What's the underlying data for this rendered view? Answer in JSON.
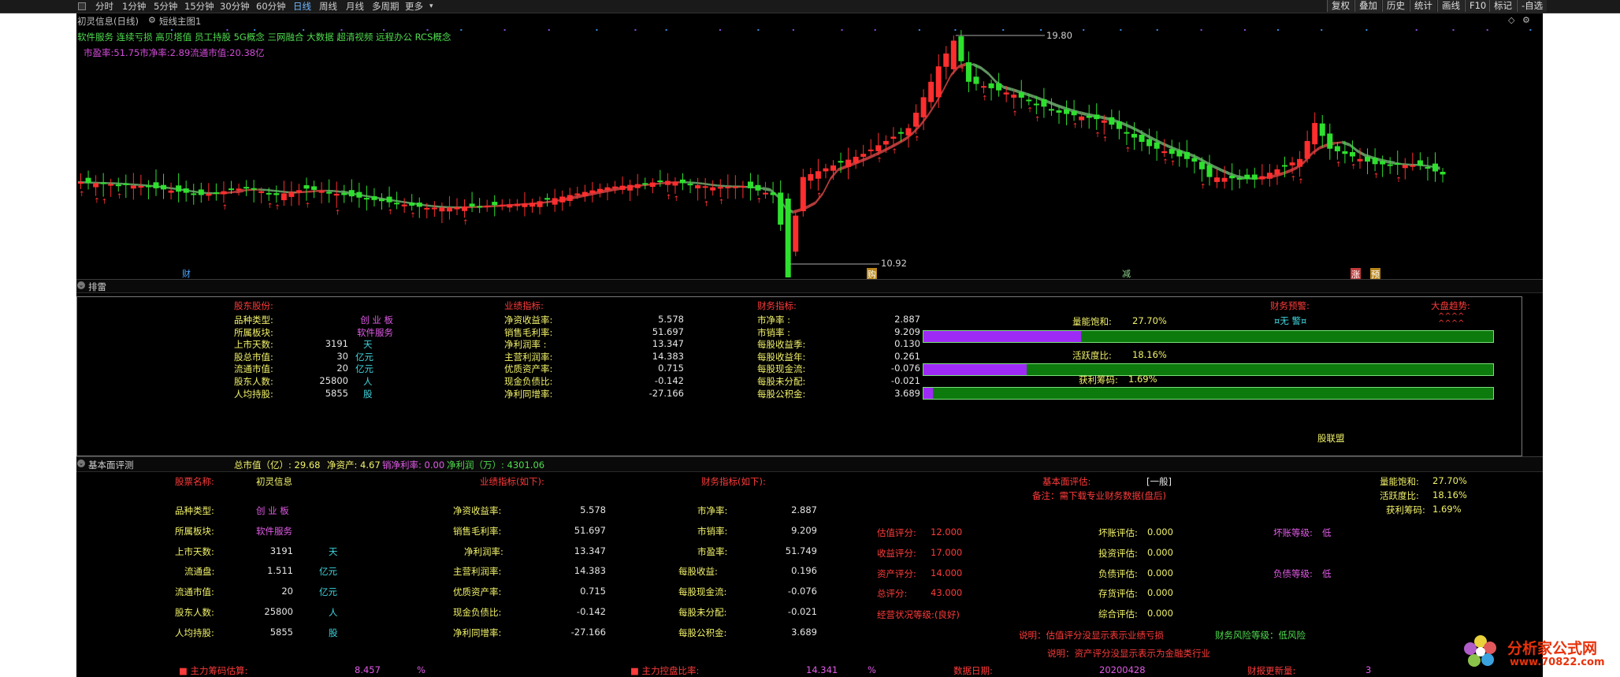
{
  "toolbar": {
    "periods": [
      "分时",
      "1分钟",
      "5分钟",
      "15分钟",
      "30分钟",
      "60分钟",
      "日线",
      "周线",
      "月线",
      "多周期",
      "更多"
    ],
    "active_period": "日线",
    "right_buttons": [
      "复权",
      "叠加",
      "历史",
      "统计",
      "画线",
      "F10",
      "标记",
      "-自选"
    ]
  },
  "chart": {
    "title": "初灵信息(日线)",
    "indicator": "短线主图1",
    "concepts": "软件服务 连续亏损 高贝塔值 员工持股 5G概念 三网融合 大数据 超清视频 远程办公 RCS概念",
    "pe_line": "市盈率:51.75市净率:2.89流通市值:20.38亿",
    "high_label": "19.80",
    "low_label": "10.92",
    "markers": [
      "财",
      "购",
      "减",
      "涨",
      "预"
    ]
  },
  "chart_data": {
    "type": "candlestick",
    "note_high": 19.8,
    "note_low": 10.92
  },
  "section1": {
    "title": "排雷",
    "headers": {
      "holder": "股东股份:",
      "perf": "业绩指标:",
      "fin": "财务指标:",
      "warn": "财务预警:",
      "trend": "大盘趋势:"
    },
    "warn_value": "¤无 警¤",
    "trend_value": "^^^^\n^^^^",
    "holder_rows": [
      {
        "label": "品种类型:",
        "value": "创 业 板",
        "unit": ""
      },
      {
        "label": "所属板块:",
        "value": "软件服务",
        "unit": ""
      },
      {
        "label": "上市天数:",
        "value": "3191",
        "unit": "天"
      },
      {
        "label": "股总市值:",
        "value": "30",
        "unit": "亿元"
      },
      {
        "label": "流通市值:",
        "value": "20",
        "unit": "亿元"
      },
      {
        "label": "股东人数:",
        "value": "25800",
        "unit": "人"
      },
      {
        "label": "人均持股:",
        "value": "5855",
        "unit": "股"
      }
    ],
    "perf_rows": [
      {
        "label": "净资收益率:",
        "value": "5.578"
      },
      {
        "label": "销售毛利率:",
        "value": "51.697"
      },
      {
        "label": "净利润率 :",
        "value": "13.347"
      },
      {
        "label": "主营利润率:",
        "value": "14.383"
      },
      {
        "label": "优质资产率:",
        "value": "0.715"
      },
      {
        "label": "现金负债比:",
        "value": "-0.142"
      },
      {
        "label": "净利同增率:",
        "value": "-27.166"
      }
    ],
    "fin_rows": [
      {
        "label": "市净率 :",
        "value": "2.887"
      },
      {
        "label": "市销率 :",
        "value": "9.209"
      },
      {
        "label": "每股收益季:",
        "value": "0.130"
      },
      {
        "label": "每股收益年:",
        "value": "0.261"
      },
      {
        "label": "每股现金流:",
        "value": "-0.076"
      },
      {
        "label": "每股未分配:",
        "value": "-0.021"
      },
      {
        "label": "每股公积金:",
        "value": "3.689"
      }
    ],
    "bars": [
      {
        "label": "量能饱和:",
        "value": "27.70%",
        "fraction": 0.277
      },
      {
        "label": "活跃度比:",
        "value": "18.16%",
        "fraction": 0.1816
      },
      {
        "label": "获利筹码:",
        "value": "1.69%",
        "fraction": 0.0169
      }
    ],
    "footer": "股联盟"
  },
  "section2": {
    "title": "基本面评测",
    "summary": {
      "mcap": "总市值（亿）: 29.68",
      "nav": "净资产: 4.67",
      "sales_profit": "销净利率: 0.00",
      "net_profit": "净利润（万）: 4301.06"
    },
    "stock_name_label": "股票名称:",
    "stock_name": "初灵信息",
    "perf_header": "业绩指标(如下):",
    "fin_header": "财务指标(如下):",
    "eval_label": "基本面评估:",
    "eval_value": "[一般]",
    "note": "备注：需下载专业财务数据(盘后)",
    "right_stats": [
      {
        "label": "量能饱和:",
        "value": "27.70%"
      },
      {
        "label": "活跃度比:",
        "value": "18.16%"
      },
      {
        "label": "获利筹码:",
        "value": "1.69%"
      }
    ],
    "holder_rows": [
      {
        "label": "品种类型:",
        "value": "创 业 板",
        "unit": ""
      },
      {
        "label": "所属板块:",
        "value": "软件服务",
        "unit": ""
      },
      {
        "label": "上市天数:",
        "value": "3191",
        "unit": "天"
      },
      {
        "label": "流通盘:",
        "value": "1.511",
        "unit": "亿元"
      },
      {
        "label": "流通市值:",
        "value": "20",
        "unit": "亿元"
      },
      {
        "label": "股东人数:",
        "value": "25800",
        "unit": "人"
      },
      {
        "label": "人均持股:",
        "value": "5855",
        "unit": "股"
      }
    ],
    "perf_rows": [
      {
        "label": "净资收益率:",
        "value": "5.578"
      },
      {
        "label": "销售毛利率:",
        "value": "51.697"
      },
      {
        "label": "净利润率:",
        "value": "13.347"
      },
      {
        "label": "主营利润率:",
        "value": "14.383"
      },
      {
        "label": "优质资产率:",
        "value": "0.715"
      },
      {
        "label": "现金负债比:",
        "value": "-0.142"
      },
      {
        "label": "净利同增率:",
        "value": "-27.166"
      }
    ],
    "fin_rows": [
      {
        "label": "市净率:",
        "value": "2.887"
      },
      {
        "label": "市销率:",
        "value": "9.209"
      },
      {
        "label": "市盈率:",
        "value": "51.749"
      },
      {
        "label": "每股收益:",
        "value": "0.196"
      },
      {
        "label": "每股现金流:",
        "value": "-0.076"
      },
      {
        "label": "每股未分配:",
        "value": "-0.021"
      },
      {
        "label": "每股公积金:",
        "value": "3.689"
      }
    ],
    "scores": [
      {
        "label": "估值评分:",
        "value": "12.000"
      },
      {
        "label": "收益评分:",
        "value": "17.000"
      },
      {
        "label": "资产评分:",
        "value": "14.000"
      },
      {
        "label": "总评分:",
        "value": "43.000"
      }
    ],
    "evals": [
      {
        "label": "坏账评估:",
        "value": "0.000"
      },
      {
        "label": "投资评估:",
        "value": "0.000"
      },
      {
        "label": "负债评估:",
        "value": "0.000"
      },
      {
        "label": "存货评估:",
        "value": "0.000"
      },
      {
        "label": "综合评估:",
        "value": "0.000"
      }
    ],
    "levels": [
      {
        "label": "坏账等级:",
        "value": "低"
      },
      {
        "label": "负债等级:",
        "value": "低"
      }
    ],
    "status": "经营状况等级:(良好)",
    "explain1": "说明：估值评分没显示表示业绩亏损",
    "risk": "财务风险等级：低风险",
    "explain2": "说明：资产评分没显示表示为金融类行业",
    "bottom": [
      {
        "label": "■ 主力筹码估算:",
        "value": "8.457",
        "unit": "%"
      },
      {
        "label": "■ 主力控盘比率:",
        "value": "14.341",
        "unit": "%"
      },
      {
        "label": "数据日期:",
        "value": "20200428",
        "unit": ""
      },
      {
        "label": "财报更新量:",
        "value": "3",
        "unit": ""
      }
    ]
  },
  "watermark": {
    "name": "分析家公式网",
    "url": "www.70822.com"
  }
}
